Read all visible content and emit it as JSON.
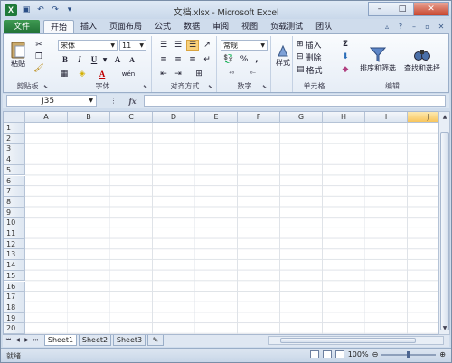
{
  "window": {
    "title": "文档.xlsx - Microsoft Excel"
  },
  "qat": {
    "app_icon": "X"
  },
  "tabs": {
    "file": "文件",
    "items": [
      "开始",
      "插入",
      "页面布局",
      "公式",
      "数据",
      "审阅",
      "视图",
      "负载测试",
      "团队"
    ],
    "active": "开始"
  },
  "ribbon": {
    "clipboard": {
      "paste": "粘贴",
      "label": "剪贴板"
    },
    "font": {
      "name": "宋体",
      "size": "11",
      "label": "字体",
      "bold": "B",
      "italic": "I",
      "underline": "U",
      "grow": "A",
      "shrink": "A",
      "font_color": "A",
      "phonetic": "wén"
    },
    "alignment": {
      "label": "对齐方式"
    },
    "number": {
      "format": "常规",
      "percent": "%",
      "comma": ",",
      "label": "数字"
    },
    "styles": {
      "label": "样式"
    },
    "cells": {
      "insert": "插入",
      "delete": "删除",
      "format": "格式",
      "label": "单元格"
    },
    "editing": {
      "sort_filter": "排序和筛选",
      "find_select": "查找和选择",
      "label": "编辑",
      "sum": "Σ"
    }
  },
  "formula_bar": {
    "name_box": "J35",
    "fx": "fx",
    "formula": ""
  },
  "grid": {
    "columns": [
      "A",
      "B",
      "C",
      "D",
      "E",
      "F",
      "G",
      "H",
      "I",
      "J"
    ],
    "selected_column": "J",
    "rows": [
      "1",
      "2",
      "3",
      "4",
      "5",
      "6",
      "7",
      "8",
      "9",
      "10",
      "11",
      "12",
      "13",
      "14",
      "15",
      "16",
      "17",
      "18",
      "19",
      "20"
    ]
  },
  "sheets": {
    "tabs": [
      "Sheet1",
      "Sheet2",
      "Sheet3"
    ],
    "active": "Sheet1"
  },
  "statusbar": {
    "status": "就绪",
    "zoom": "100%"
  },
  "colors": {
    "file_tab": "#1e6e34",
    "selected_header": "#f8c55c",
    "ribbon_bg": "#e6edf6"
  }
}
